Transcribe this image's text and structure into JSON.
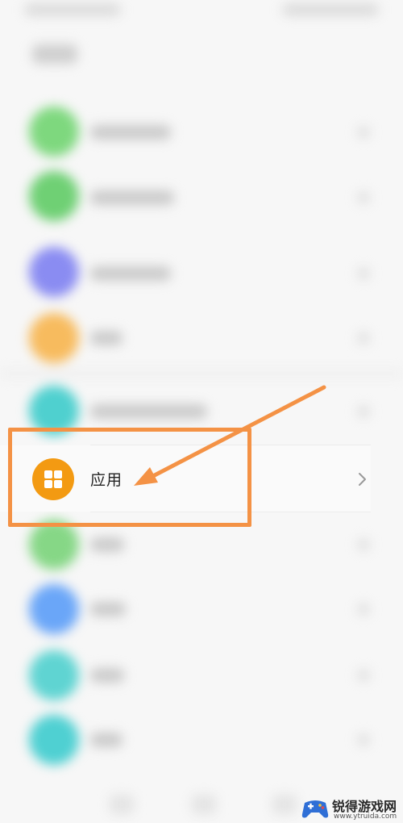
{
  "settings_list": {
    "app_item": {
      "label": "应用",
      "icon": "apps-grid-icon",
      "chevron_icon": "chevron-right-icon"
    }
  },
  "annotation": {
    "color": "#f49245"
  },
  "watermark": {
    "title": "锐得游戏网",
    "url": "www.ytruida.com",
    "logo_icon": "controller-logo"
  },
  "colors": {
    "app_icon": "#f39a12"
  }
}
